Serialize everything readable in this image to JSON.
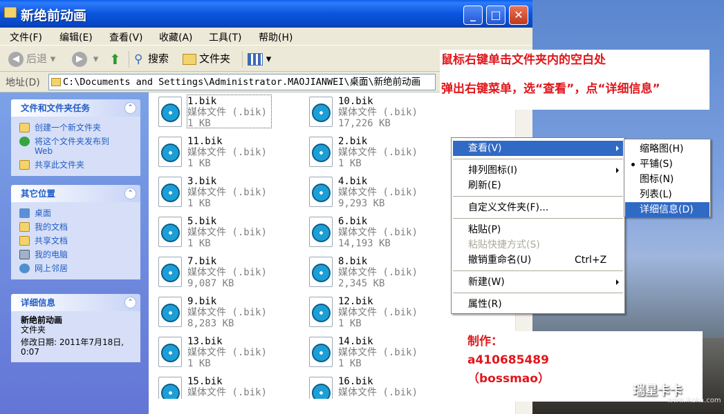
{
  "window": {
    "title": "新绝前动画",
    "buttons": {
      "minimize": "_",
      "maximize": "□",
      "close": "✕"
    }
  },
  "menubar": {
    "items": [
      "文件(F)",
      "编辑(E)",
      "查看(V)",
      "收藏(A)",
      "工具(T)",
      "帮助(H)"
    ]
  },
  "toolbar": {
    "back": "后退",
    "search": "搜索",
    "folders": "文件夹"
  },
  "address": {
    "label": "地址(D)",
    "value": "C:\\Documents and Settings\\Administrator.MAOJIANWEI\\桌面\\新绝前动画"
  },
  "sidebar": {
    "tasks": {
      "title": "文件和文件夹任务",
      "items": [
        "创建一个新文件夹",
        "将这个文件夹发布到",
        "Web",
        "共享此文件夹"
      ]
    },
    "places": {
      "title": "其它位置",
      "items": [
        "桌面",
        "我的文档",
        "共享文档",
        "我的电脑",
        "网上邻居"
      ]
    },
    "details": {
      "title": "详细信息",
      "name": "新绝前动画",
      "type": "文件夹",
      "modified_label": "修改日期: 2011年7月18日,",
      "modified_time": "0:07"
    }
  },
  "files": [
    {
      "name": "1.bik",
      "type": "媒体文件 (.bik)",
      "size": "1 KB"
    },
    {
      "name": "10.bik",
      "type": "媒体文件 (.bik)",
      "size": "17,226 KB"
    },
    {
      "name": "11.bik",
      "type": "媒体文件 (.bik)",
      "size": "1 KB"
    },
    {
      "name": "2.bik",
      "type": "媒体文件 (.bik)",
      "size": "1 KB"
    },
    {
      "name": "3.bik",
      "type": "媒体文件 (.bik)",
      "size": "1 KB"
    },
    {
      "name": "4.bik",
      "type": "媒体文件 (.bik)",
      "size": "9,293 KB"
    },
    {
      "name": "5.bik",
      "type": "媒体文件 (.bik)",
      "size": "1 KB"
    },
    {
      "name": "6.bik",
      "type": "媒体文件 (.bik)",
      "size": "14,193 KB"
    },
    {
      "name": "7.bik",
      "type": "媒体文件 (.bik)",
      "size": "9,087 KB"
    },
    {
      "name": "8.bik",
      "type": "媒体文件 (.bik)",
      "size": "2,345 KB"
    },
    {
      "name": "9.bik",
      "type": "媒体文件 (.bik)",
      "size": "8,283 KB"
    },
    {
      "name": "12.bik",
      "type": "媒体文件 (.bik)",
      "size": "1 KB"
    },
    {
      "name": "13.bik",
      "type": "媒体文件 (.bik)",
      "size": "1 KB"
    },
    {
      "name": "14.bik",
      "type": "媒体文件 (.bik)",
      "size": "1 KB"
    },
    {
      "name": "15.bik",
      "type": "媒体文件 (.bik)",
      "size": ""
    },
    {
      "name": "16.bik",
      "type": "媒体文件 (.bik)",
      "size": ""
    }
  ],
  "context_menu": {
    "view": "查看(V)",
    "arrange": "排列图标(I)",
    "refresh": "刷新(E)",
    "customize": "自定义文件夹(F)...",
    "paste": "粘贴(P)",
    "paste_shortcut": "粘贴快捷方式(S)",
    "undo_rename": "撤销重命名(U)",
    "undo_shortcut": "Ctrl+Z",
    "new": "新建(W)",
    "properties": "属性(R)"
  },
  "view_submenu": {
    "items": [
      "缩略图(H)",
      "平铺(S)",
      "图标(N)",
      "列表(L)",
      "详细信息(D)"
    ],
    "checked_index": 1,
    "highlighted_index": 4
  },
  "annotations": {
    "line1": "鼠标右键单击文件夹内的空白处",
    "line2": "弹出右键菜单，选“查看”，点“详细信息”",
    "credit_label": "制作：",
    "credit_id": "a410685489",
    "credit_name": "（bossmao）"
  },
  "watermark": {
    "brand": "瑞星卡卡",
    "url": "www.ikaka.com"
  },
  "colors": {
    "titlebar": "#0a55dd",
    "selection": "#316ac5",
    "annotation_red": "#e0161b",
    "sidebar_link": "#215dc6"
  }
}
